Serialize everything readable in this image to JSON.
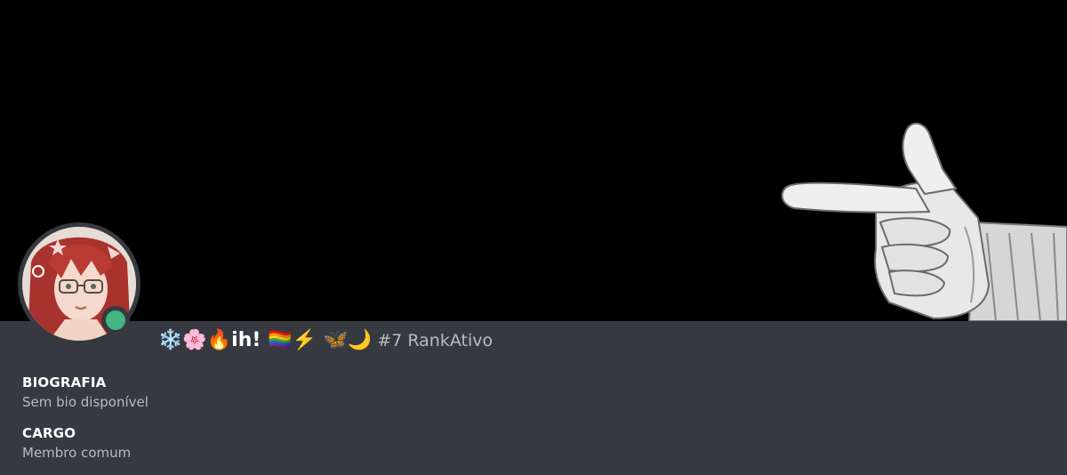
{
  "profile": {
    "username": "❄️🌸🔥ih! 🏳️‍🌈⚡️ 🦋🌙",
    "tag": "#7 RankAtivo",
    "status_color": "#43b581",
    "avatar_icon": "anime-avatar-icon",
    "banner_icon": "pointing-hand-icon"
  },
  "sections": {
    "bio": {
      "title": "BIOGRAFIA",
      "value": "Sem bio disponível"
    },
    "role": {
      "title": "CARGO",
      "value": "Membro comum"
    }
  },
  "colors": {
    "background": "#36393f",
    "banner": "#000000",
    "text_primary": "#ffffff",
    "text_secondary": "#b9bbbe"
  }
}
